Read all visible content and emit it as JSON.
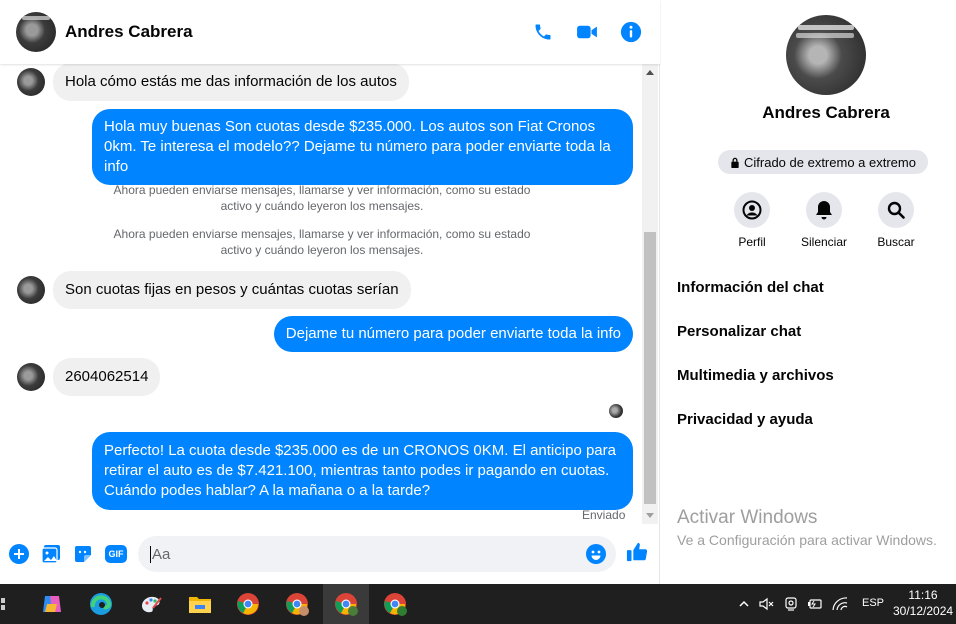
{
  "colors": {
    "accent": "#0084ff",
    "incoming_bubble": "#f0f0f0",
    "muted_text": "#65676b"
  },
  "chat": {
    "contact_name": "Andres Cabrera",
    "header_icons": [
      "phone-icon",
      "video-camera-icon",
      "info-icon"
    ],
    "messages": [
      {
        "side": "in",
        "text": "Hola cómo estás me das información de los autos"
      },
      {
        "side": "out",
        "text": "Hola muy buenas Son cuotas desde $235.000. Los autos son Fiat Cronos 0km. Te interesa el modelo?? Dejame tu número para poder enviarte toda la info"
      },
      {
        "side": "system",
        "text": "Ahora pueden enviarse mensajes, llamarse y ver información, como su estado activo y cuándo leyeron los mensajes."
      },
      {
        "side": "system",
        "text": "Ahora pueden enviarse mensajes, llamarse y ver información, como su estado activo y cuándo leyeron los mensajes."
      },
      {
        "side": "in",
        "text": "Son cuotas fijas en pesos y cuántas cuotas serían"
      },
      {
        "side": "out",
        "text": "Dejame tu número para poder enviarte toda la info"
      },
      {
        "side": "in",
        "text": "2604062514"
      },
      {
        "side": "out",
        "text": "Perfecto! La cuota desde $235.000 es de un CRONOS 0KM. El anticipo para retirar el auto es de $7.421.100, mientras tanto podes ir pagando en cuotas. Cuándo podes hablar? A la mañana o a la tarde?"
      }
    ],
    "sent_status": "Enviado",
    "composer_placeholder": "Aa",
    "composer_icons": [
      "plus-circle-icon",
      "photo-icon",
      "sticker-icon",
      "gif-icon",
      "emoji-icon",
      "thumbs-up-icon"
    ],
    "gif_label": "GIF"
  },
  "side": {
    "name": "Andres Cabrera",
    "encryption_label": "Cifrado de extremo a extremo",
    "actions": [
      {
        "label": "Perfil",
        "icon": "profile-icon"
      },
      {
        "label": "Silenciar",
        "icon": "bell-icon"
      },
      {
        "label": "Buscar",
        "icon": "search-icon"
      }
    ],
    "menu": [
      "Información del chat",
      "Personalizar chat",
      "Multimedia y archivos",
      "Privacidad y ayuda"
    ],
    "watermark_title": "Activar Windows",
    "watermark_sub": "Ve a Configuración para activar Windows."
  },
  "taskbar": {
    "language": "ESP",
    "time": "11:16",
    "date": "30/12/2024",
    "apps": [
      "start-icon",
      "copilot-icon",
      "edge-icon",
      "paint-icon",
      "file-explorer-icon",
      "chrome-icon",
      "chrome-profile-icon",
      "chrome-v-icon",
      "chrome-t-icon"
    ]
  }
}
